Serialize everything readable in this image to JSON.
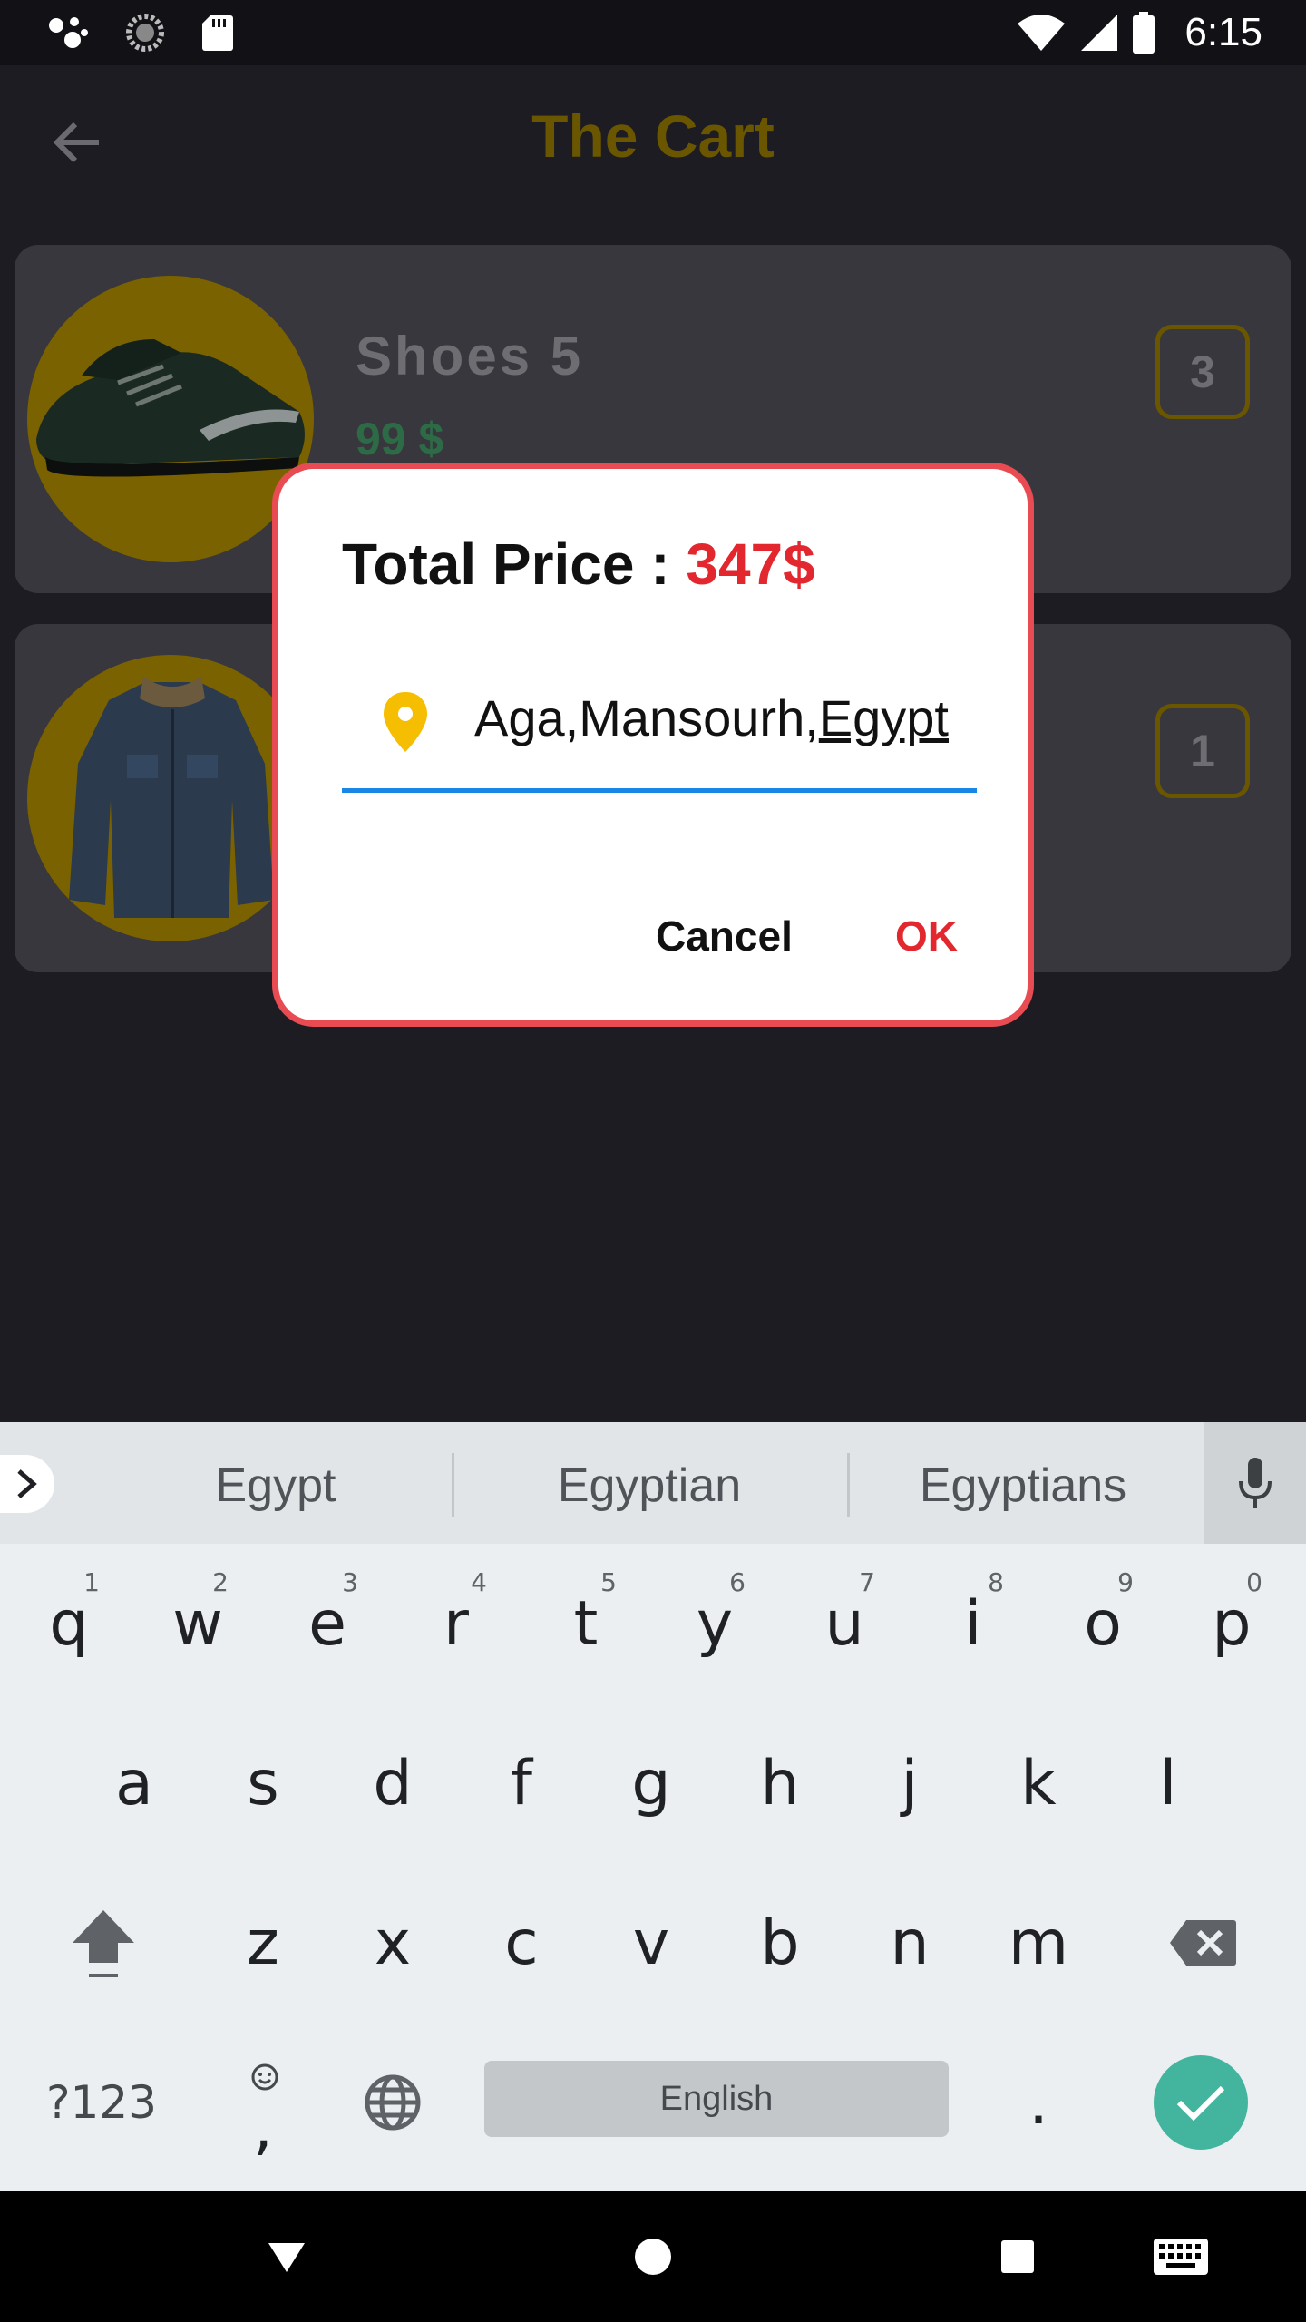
{
  "status_bar": {
    "time": "6:15",
    "icons": [
      "assistant-dots-icon",
      "sync-icon",
      "sd-card-icon",
      "wifi-icon",
      "signal-icon",
      "battery-icon"
    ]
  },
  "app_bar": {
    "title": "The Cart",
    "back_icon": "arrow-back-icon"
  },
  "cart": {
    "items": [
      {
        "name": "Shoes 5",
        "price": "99 $",
        "quantity": "3",
        "image": "sneaker"
      },
      {
        "name": "",
        "price": "",
        "quantity": "1",
        "image": "denim-jacket"
      }
    ]
  },
  "dialog": {
    "total_label": "Total Price : ",
    "total_value": "347$",
    "address_prefix": "Aga,Mansourh,",
    "address_composing": "Egypt",
    "cancel_label": "Cancel",
    "ok_label": "OK",
    "colors": {
      "border": "#e94b52",
      "accent": "#e2272e",
      "underline": "#1a86e5",
      "pin": "#f6be00"
    }
  },
  "keyboard": {
    "suggestions": [
      "Egypt",
      "Egyptian",
      "Egyptians"
    ],
    "row1": [
      "q",
      "w",
      "e",
      "r",
      "t",
      "y",
      "u",
      "i",
      "o",
      "p"
    ],
    "row1_hints": [
      "1",
      "2",
      "3",
      "4",
      "5",
      "6",
      "7",
      "8",
      "9",
      "0"
    ],
    "row2": [
      "a",
      "s",
      "d",
      "f",
      "g",
      "h",
      "j",
      "k",
      "l"
    ],
    "row3": [
      "z",
      "x",
      "c",
      "v",
      "b",
      "n",
      "m"
    ],
    "symbols_label": "?123",
    "emoji_comma": ",",
    "space_label": "English",
    "period": "."
  }
}
